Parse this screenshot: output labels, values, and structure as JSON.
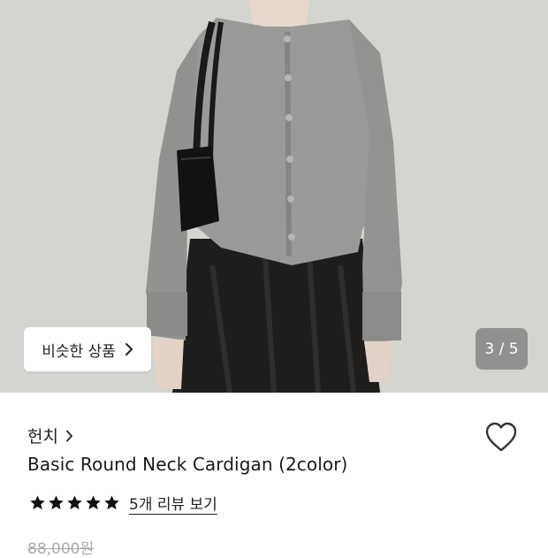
{
  "gallery": {
    "similar_label": "비슷한 상품",
    "similar_arrow": "›",
    "counter": "3 / 5"
  },
  "product": {
    "brand": "헌치",
    "brand_arrow": "›",
    "name": "Basic Round Neck Cardigan (2color)",
    "rating_stars": 5,
    "review_link": "5개 리뷰 보기",
    "original_price": "88,000원"
  },
  "icons": {
    "heart": "heart-outline-icon",
    "star": "star-filled-icon",
    "chevron": "chevron-right-icon"
  },
  "colors": {
    "background": "#ffffff",
    "counter_bg": "#5a5a5a",
    "star": "#111111",
    "muted_price": "#aaaaaa"
  }
}
